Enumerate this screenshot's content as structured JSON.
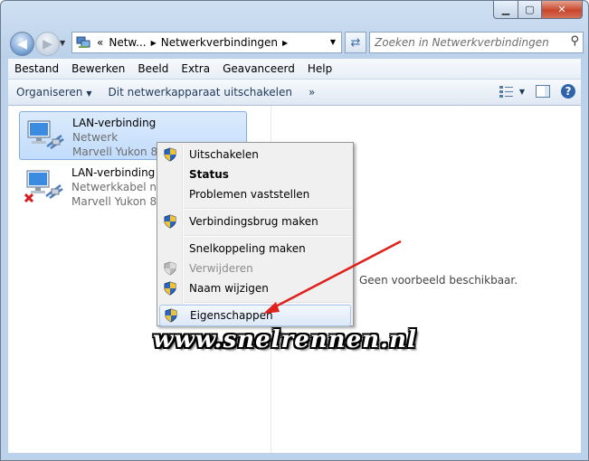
{
  "window": {
    "controls": {
      "minimize": "▁",
      "maximize": "▢",
      "close": "✕"
    }
  },
  "nav": {
    "address_prefix": "«",
    "breadcrumb": [
      "Netw...",
      "Netwerkverbindingen"
    ],
    "search_placeholder": "Zoeken in Netwerkverbindingen"
  },
  "menubar": [
    "Bestand",
    "Bewerken",
    "Beeld",
    "Extra",
    "Geavanceerd",
    "Help"
  ],
  "commandbar": {
    "organize": "Organiseren",
    "disable_device": "Dit netwerkapparaat uitschakelen",
    "more": "»"
  },
  "connections": [
    {
      "name": "LAN-verbinding",
      "status": "Netwerk",
      "adapter": "Marvell Yukon 88E",
      "selected": true,
      "error": false
    },
    {
      "name": "LAN-verbinding 2",
      "status": "Netwerkkabel niet",
      "adapter": "Marvell Yukon 88E",
      "selected": false,
      "error": true
    }
  ],
  "preview_text": "Geen voorbeeld beschikbaar.",
  "context_menu": [
    {
      "label": "Uitschakelen",
      "shield": true,
      "bold": false,
      "disabled": false
    },
    {
      "label": "Status",
      "shield": false,
      "bold": true,
      "disabled": false
    },
    {
      "label": "Problemen vaststellen",
      "shield": false,
      "bold": false,
      "disabled": false
    },
    {
      "label": "Verbindingsbrug maken",
      "shield": true,
      "bold": false,
      "disabled": false
    },
    {
      "label": "Snelkoppeling maken",
      "shield": false,
      "bold": false,
      "disabled": false
    },
    {
      "label": "Verwijderen",
      "shield": true,
      "bold": false,
      "disabled": true
    },
    {
      "label": "Naam wijzigen",
      "shield": true,
      "bold": false,
      "disabled": false
    },
    {
      "label": "Eigenschappen",
      "shield": true,
      "bold": false,
      "disabled": false,
      "highlighted": true
    }
  ],
  "watermark": "www.snelrennen.nl",
  "colors": {
    "annotation_arrow": "#e0201b",
    "selection": "#c1dcfc",
    "close_button": "#c8462c"
  }
}
